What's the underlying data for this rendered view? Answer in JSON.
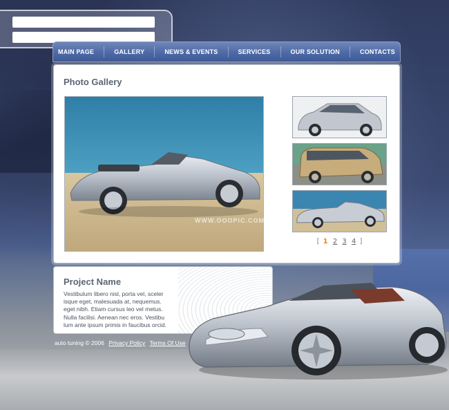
{
  "nav": {
    "items": [
      "MAIN PAGE",
      "GALLERY",
      "NEWS & EVENTS",
      "SERVICES",
      "OUR SOLUTION",
      "CONTACTS"
    ]
  },
  "gallery": {
    "title": "Photo Gallery",
    "pager": {
      "open": "[",
      "close": "]",
      "pages": [
        "1",
        "2",
        "3",
        "4"
      ],
      "active": "1"
    }
  },
  "project": {
    "title": "Project Name",
    "text": "Vestibulum libero nisl, porta vel, sceler isque eget, malesuada at, nequemus. eget nibh. Etiam cursus leo vel metus. Nulla facilisi. Aenean nec eros. Vestibu lum ante ipsum primis in faucibus orcid."
  },
  "footer": {
    "copyright": "auto tuning © 2006",
    "links": [
      "Privacy Policy",
      "Terms Of Use"
    ]
  },
  "watermark": "WWW.OOOPIC.COM",
  "colors": {
    "nav_bg": "#4e6aa6",
    "heading": "#5b6574",
    "pager_active": "#e58a10",
    "car_silver": "#c9ced6"
  },
  "icons": {
    "main_photo": "silver-roadster-photo",
    "thumb_1": "silver-hatchback-photo",
    "thumb_2": "gold-minivan-photo",
    "thumb_3": "silver-roadster-photo",
    "hero": "silver-concept-roadster-photo"
  }
}
